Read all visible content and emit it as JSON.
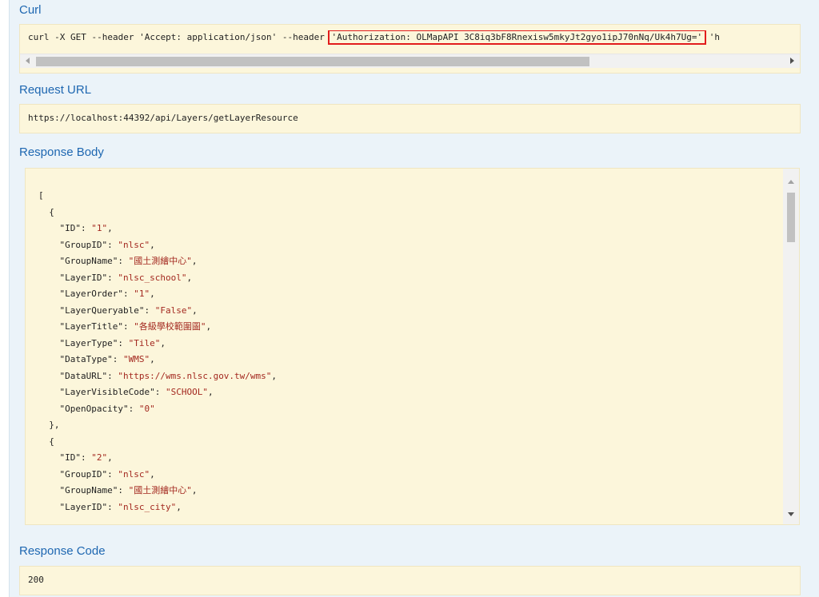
{
  "curl": {
    "heading": "Curl",
    "prefix": "curl -X GET --header 'Accept: application/json' --header ",
    "auth_header": "'Authorization: OLMapAPI 3C8iq3bF8Rnexisw5mkyJt2gyo1ipJ70nNq/Uk4h7Ug='",
    "suffix": " 'h"
  },
  "request_url": {
    "heading": "Request URL",
    "value": "https://localhost:44392/api/Layers/getLayerResource"
  },
  "response_body": {
    "heading": "Response Body",
    "lines": [
      {
        "indent": "",
        "key": "",
        "value": "",
        "punct": "["
      },
      {
        "indent": "  ",
        "key": "",
        "value": "",
        "punct": "{"
      },
      {
        "indent": "    ",
        "key": "\"ID\"",
        "value": "\"1\"",
        "punct": ","
      },
      {
        "indent": "    ",
        "key": "\"GroupID\"",
        "value": "\"nlsc\"",
        "punct": ","
      },
      {
        "indent": "    ",
        "key": "\"GroupName\"",
        "value": "\"國土測繪中心\"",
        "punct": ","
      },
      {
        "indent": "    ",
        "key": "\"LayerID\"",
        "value": "\"nlsc_school\"",
        "punct": ","
      },
      {
        "indent": "    ",
        "key": "\"LayerOrder\"",
        "value": "\"1\"",
        "punct": ","
      },
      {
        "indent": "    ",
        "key": "\"LayerQueryable\"",
        "value": "\"False\"",
        "punct": ","
      },
      {
        "indent": "    ",
        "key": "\"LayerTitle\"",
        "value": "\"各級學校範圍圖\"",
        "punct": ","
      },
      {
        "indent": "    ",
        "key": "\"LayerType\"",
        "value": "\"Tile\"",
        "punct": ","
      },
      {
        "indent": "    ",
        "key": "\"DataType\"",
        "value": "\"WMS\"",
        "punct": ","
      },
      {
        "indent": "    ",
        "key": "\"DataURL\"",
        "value": "\"https://wms.nlsc.gov.tw/wms\"",
        "punct": ","
      },
      {
        "indent": "    ",
        "key": "\"LayerVisibleCode\"",
        "value": "\"SCHOOL\"",
        "punct": ","
      },
      {
        "indent": "    ",
        "key": "\"OpenOpacity\"",
        "value": "\"0\"",
        "punct": ""
      },
      {
        "indent": "  ",
        "key": "",
        "value": "",
        "punct": "},"
      },
      {
        "indent": "  ",
        "key": "",
        "value": "",
        "punct": "{"
      },
      {
        "indent": "    ",
        "key": "\"ID\"",
        "value": "\"2\"",
        "punct": ","
      },
      {
        "indent": "    ",
        "key": "\"GroupID\"",
        "value": "\"nlsc\"",
        "punct": ","
      },
      {
        "indent": "    ",
        "key": "\"GroupName\"",
        "value": "\"國土測繪中心\"",
        "punct": ","
      },
      {
        "indent": "    ",
        "key": "\"LayerID\"",
        "value": "\"nlsc_city\"",
        "punct": ","
      }
    ]
  },
  "response_code": {
    "heading": "Response Code",
    "value": "200"
  },
  "colors": {
    "heading": "#1e67b1",
    "code_bg": "#fcf6db",
    "string_value": "#a3281f",
    "highlight_border": "#e21c1c"
  }
}
